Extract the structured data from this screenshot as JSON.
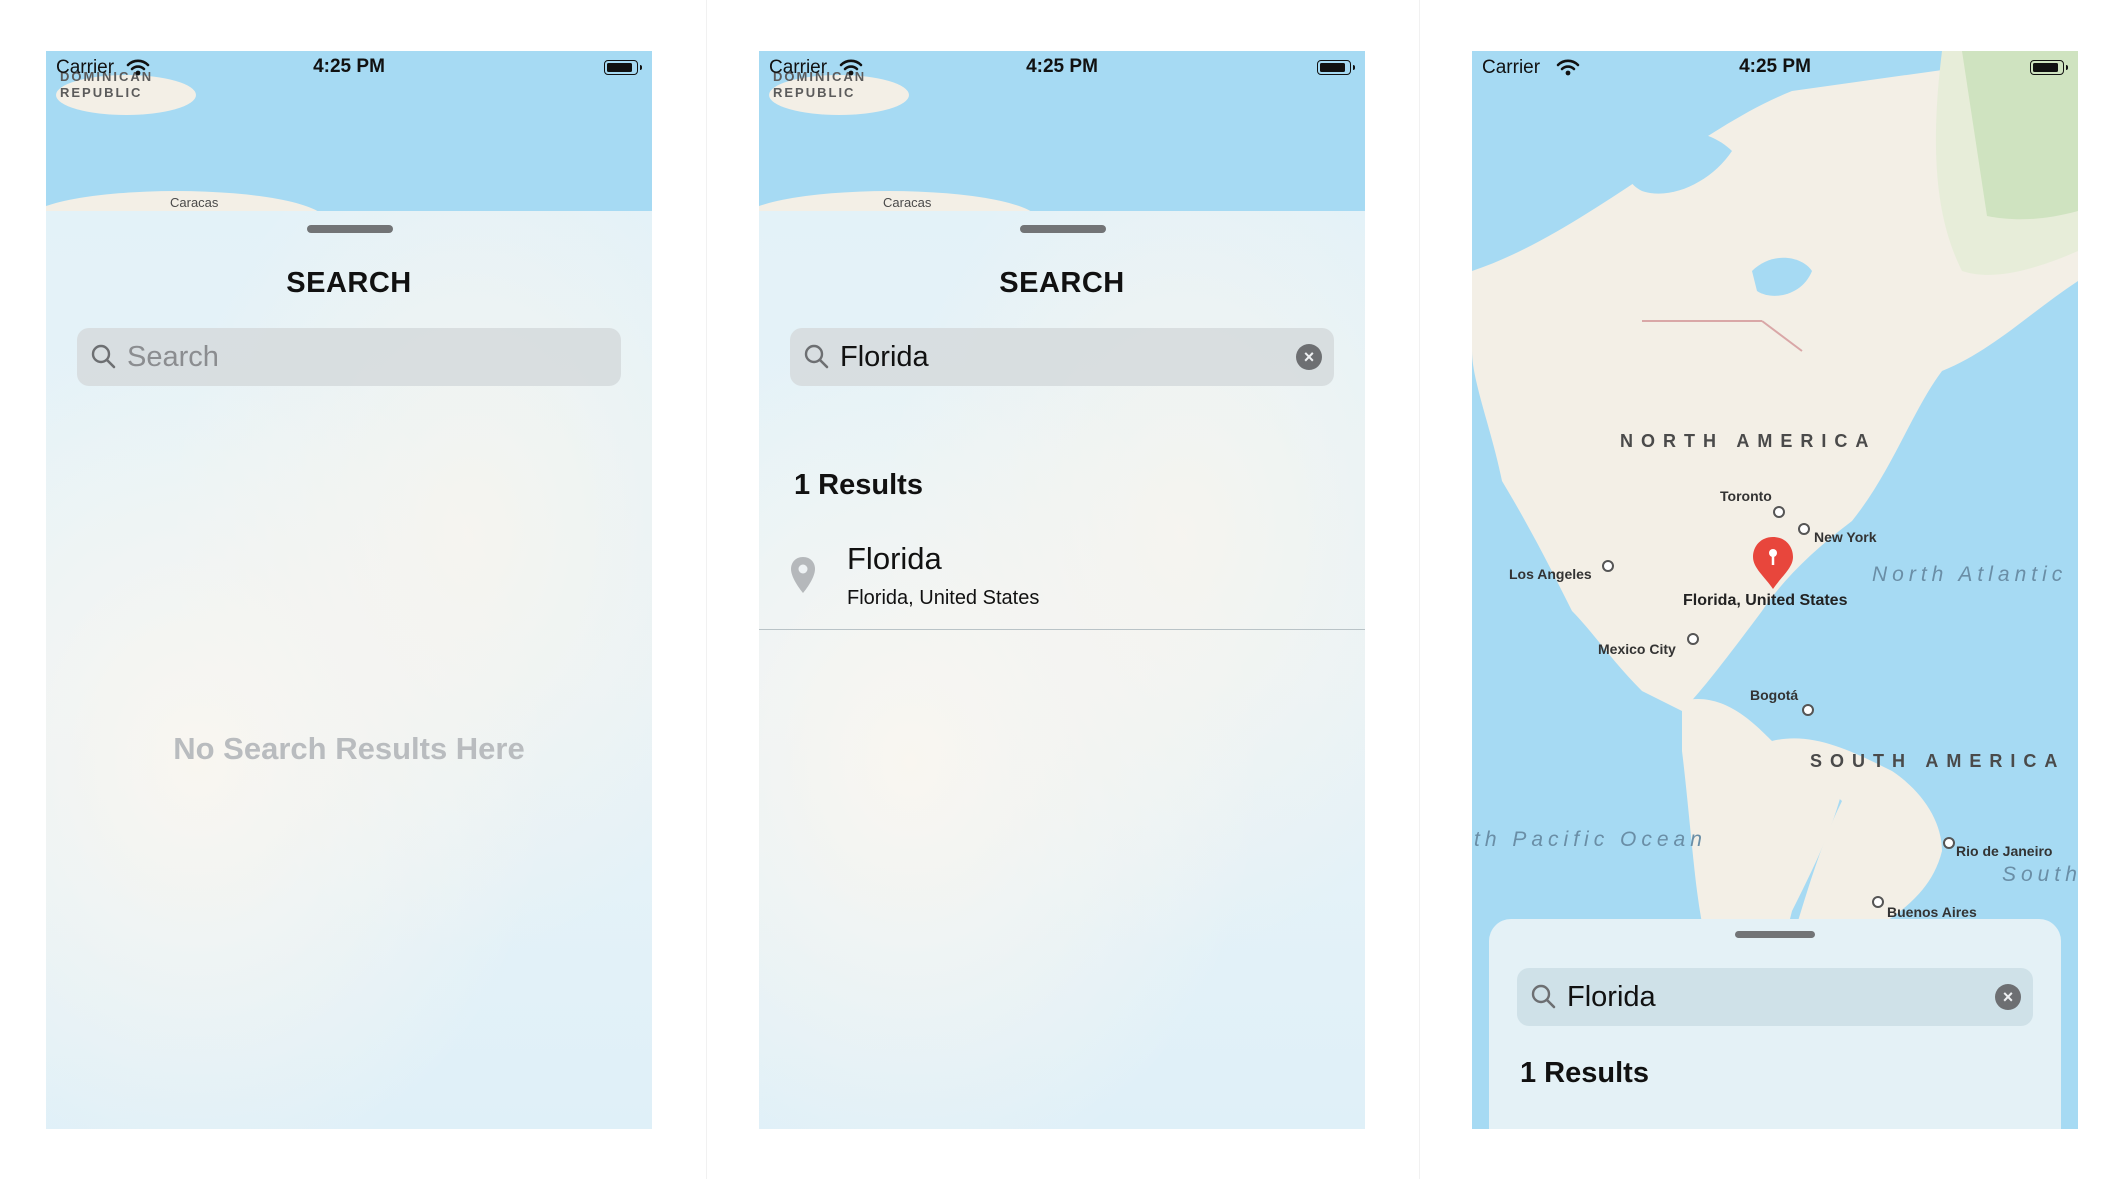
{
  "status_bar": {
    "carrier": "Carrier",
    "time": "4:25 PM"
  },
  "map_labels": {
    "dominican_republic": "DOMINICAN REPUBLIC",
    "caracas": "Caracas"
  },
  "screen_empty": {
    "title": "SEARCH",
    "search_placeholder": "Search",
    "empty_message": "No Search Results Here"
  },
  "screen_results": {
    "title": "SEARCH",
    "search_value": "Florida",
    "results_count": "1 Results",
    "results": [
      {
        "title": "Florida",
        "subtitle": "Florida, United States"
      }
    ]
  },
  "screen_map": {
    "search_value": "Florida",
    "results_count": "1 Results",
    "pin_label": "Florida, United States",
    "labels": {
      "north_america": "NORTH AMERICA",
      "south_america": "SOUTH AMERICA",
      "north_atlantic": "North Atlantic Ocean",
      "south_pacific": "th Pacific Ocean",
      "south_atlantic": "South A Oc",
      "toronto": "Toronto",
      "new_york": "New York",
      "los_angeles": "Los Angeles",
      "mexico_city": "Mexico City",
      "bogota": "Bogotá",
      "rio": "Rio de Janeiro",
      "buenos_aires": "Buenos Aires"
    }
  },
  "colors": {
    "water": "#a6daf3",
    "land": "#f3efe6",
    "pin": "#e8463c",
    "text_muted": "#b9bcbf"
  }
}
